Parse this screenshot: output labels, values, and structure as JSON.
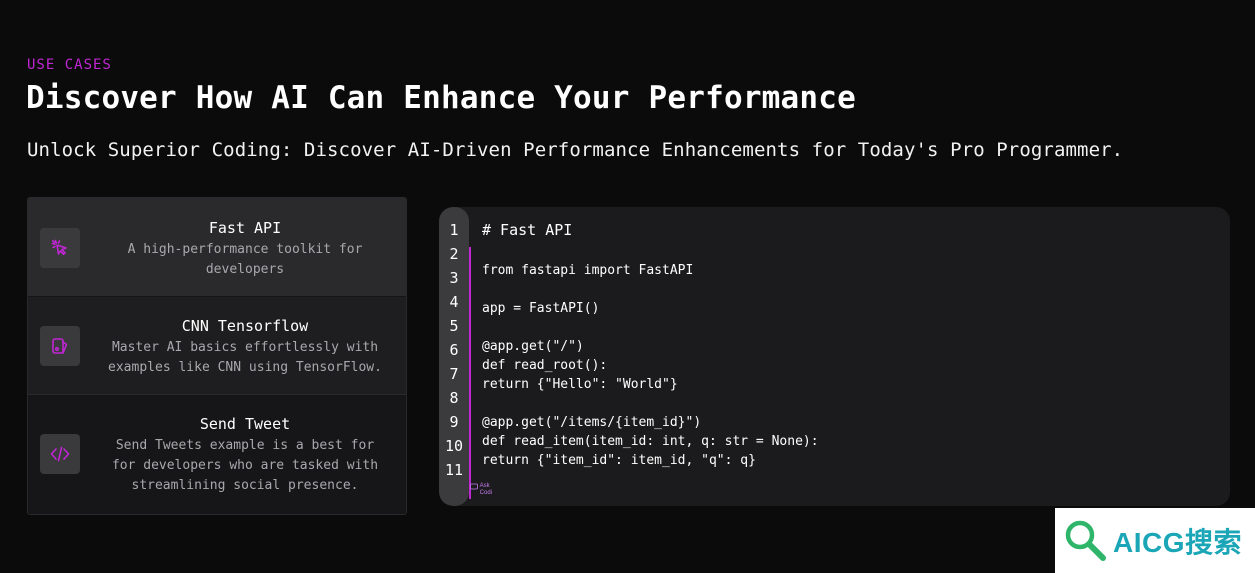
{
  "section": {
    "eyebrow": "USE CASES",
    "headline": "Discover How AI Can Enhance Your Performance",
    "subtitle": "Unlock Superior Coding: Discover AI-Driven Performance Enhancements for Today's Pro Programmer."
  },
  "use_cases": [
    {
      "title": "Fast API",
      "desc_lines": [
        "A high-performance toolkit for",
        "developers"
      ],
      "icon": "cursor-click-icon",
      "active": true
    },
    {
      "title": "CNN Tensorflow",
      "desc_lines": [
        "Master AI basics effortlessly with",
        "examples like CNN using TensorFlow."
      ],
      "icon": "shapes-icon",
      "active": false
    },
    {
      "title": "Send Tweet",
      "desc_lines": [
        "Send Tweets example is a best for",
        "for developers who are tasked with",
        "streamlining social presence."
      ],
      "icon": "code-brackets-icon",
      "active": false
    }
  ],
  "editor": {
    "line_numbers": [
      "1",
      "2",
      "3",
      "4",
      "5",
      "6",
      "7",
      "8",
      "9",
      "10",
      "11"
    ],
    "heading": "# Fast API",
    "code_lines": [
      "from fastapi import FastAPI",
      "",
      "app = FastAPI()",
      "",
      "@app.get(\"/\")",
      "def read_root():",
      "return {\"Hello\": \"World\"}",
      "",
      "@app.get(\"/items/{item_id}\")",
      "def read_item(item_id: int, q: str = None):",
      "return {\"item_id\": item_id, \"q\": q}"
    ],
    "badge_lines": [
      "Ask",
      "Codi"
    ]
  },
  "watermark": {
    "text": "AICG搜索"
  },
  "colors": {
    "accent": "#c026d3",
    "background": "#0b0b0c",
    "card_active": "#2a2a2c",
    "editor_bg": "#1b1b1d",
    "gutter_bg": "#3b3b3e"
  }
}
